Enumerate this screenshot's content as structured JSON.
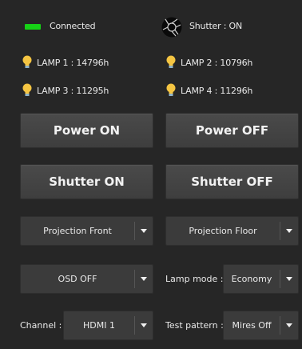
{
  "status": {
    "connection": {
      "label": "Connected",
      "color": "#16d116"
    },
    "shutter": {
      "label": "Shutter : ON",
      "icon": "camera-shutter-icon"
    }
  },
  "lamps": [
    {
      "label": "LAMP 1 : 14796h",
      "icon": "light-bulb-icon"
    },
    {
      "label": "LAMP 2 : 10796h",
      "icon": "light-bulb-icon"
    },
    {
      "label": "LAMP 3 : 11295h",
      "icon": "light-bulb-icon"
    },
    {
      "label": "LAMP 4 : 11296h",
      "icon": "light-bulb-icon"
    }
  ],
  "buttons": {
    "power_on": "Power ON",
    "power_off": "Power OFF",
    "shutter_on": "Shutter ON",
    "shutter_off": "Shutter OFF"
  },
  "selects": {
    "projection_mode": {
      "value": "Projection Front"
    },
    "projection_target": {
      "value": "Projection Floor"
    },
    "osd": {
      "value": "OSD OFF"
    },
    "lamp_mode": {
      "label": "Lamp mode :",
      "value": "Economy"
    },
    "channel": {
      "label": "Channel :",
      "value": "HDMI 1"
    },
    "test_pattern": {
      "label": "Test pattern :",
      "value": "Mires Off"
    }
  },
  "colors": {
    "background": "#262626",
    "button": "#444444",
    "bulb": "#f5c542",
    "led": "#16d116"
  }
}
